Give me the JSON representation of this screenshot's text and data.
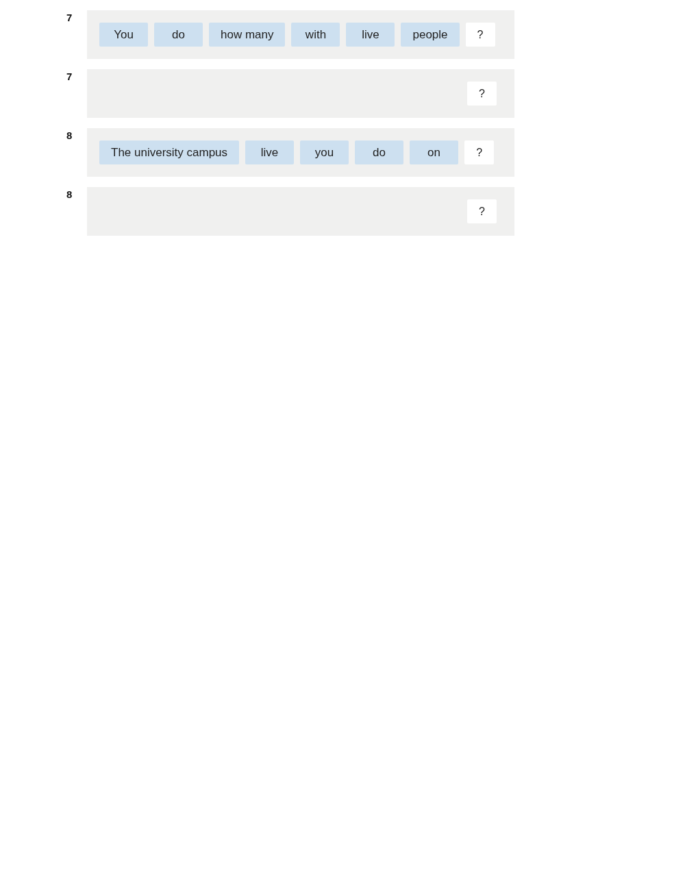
{
  "questions": [
    {
      "number": "7",
      "tiles": [
        "You",
        "do",
        "how many",
        "with",
        "live",
        "people"
      ],
      "end_mark": "?"
    },
    {
      "number": "7",
      "end_mark": "?"
    },
    {
      "number": "8",
      "tiles": [
        "The university campus",
        "live",
        "you",
        "do",
        "on"
      ],
      "end_mark": "?"
    },
    {
      "number": "8",
      "end_mark": "?"
    }
  ]
}
